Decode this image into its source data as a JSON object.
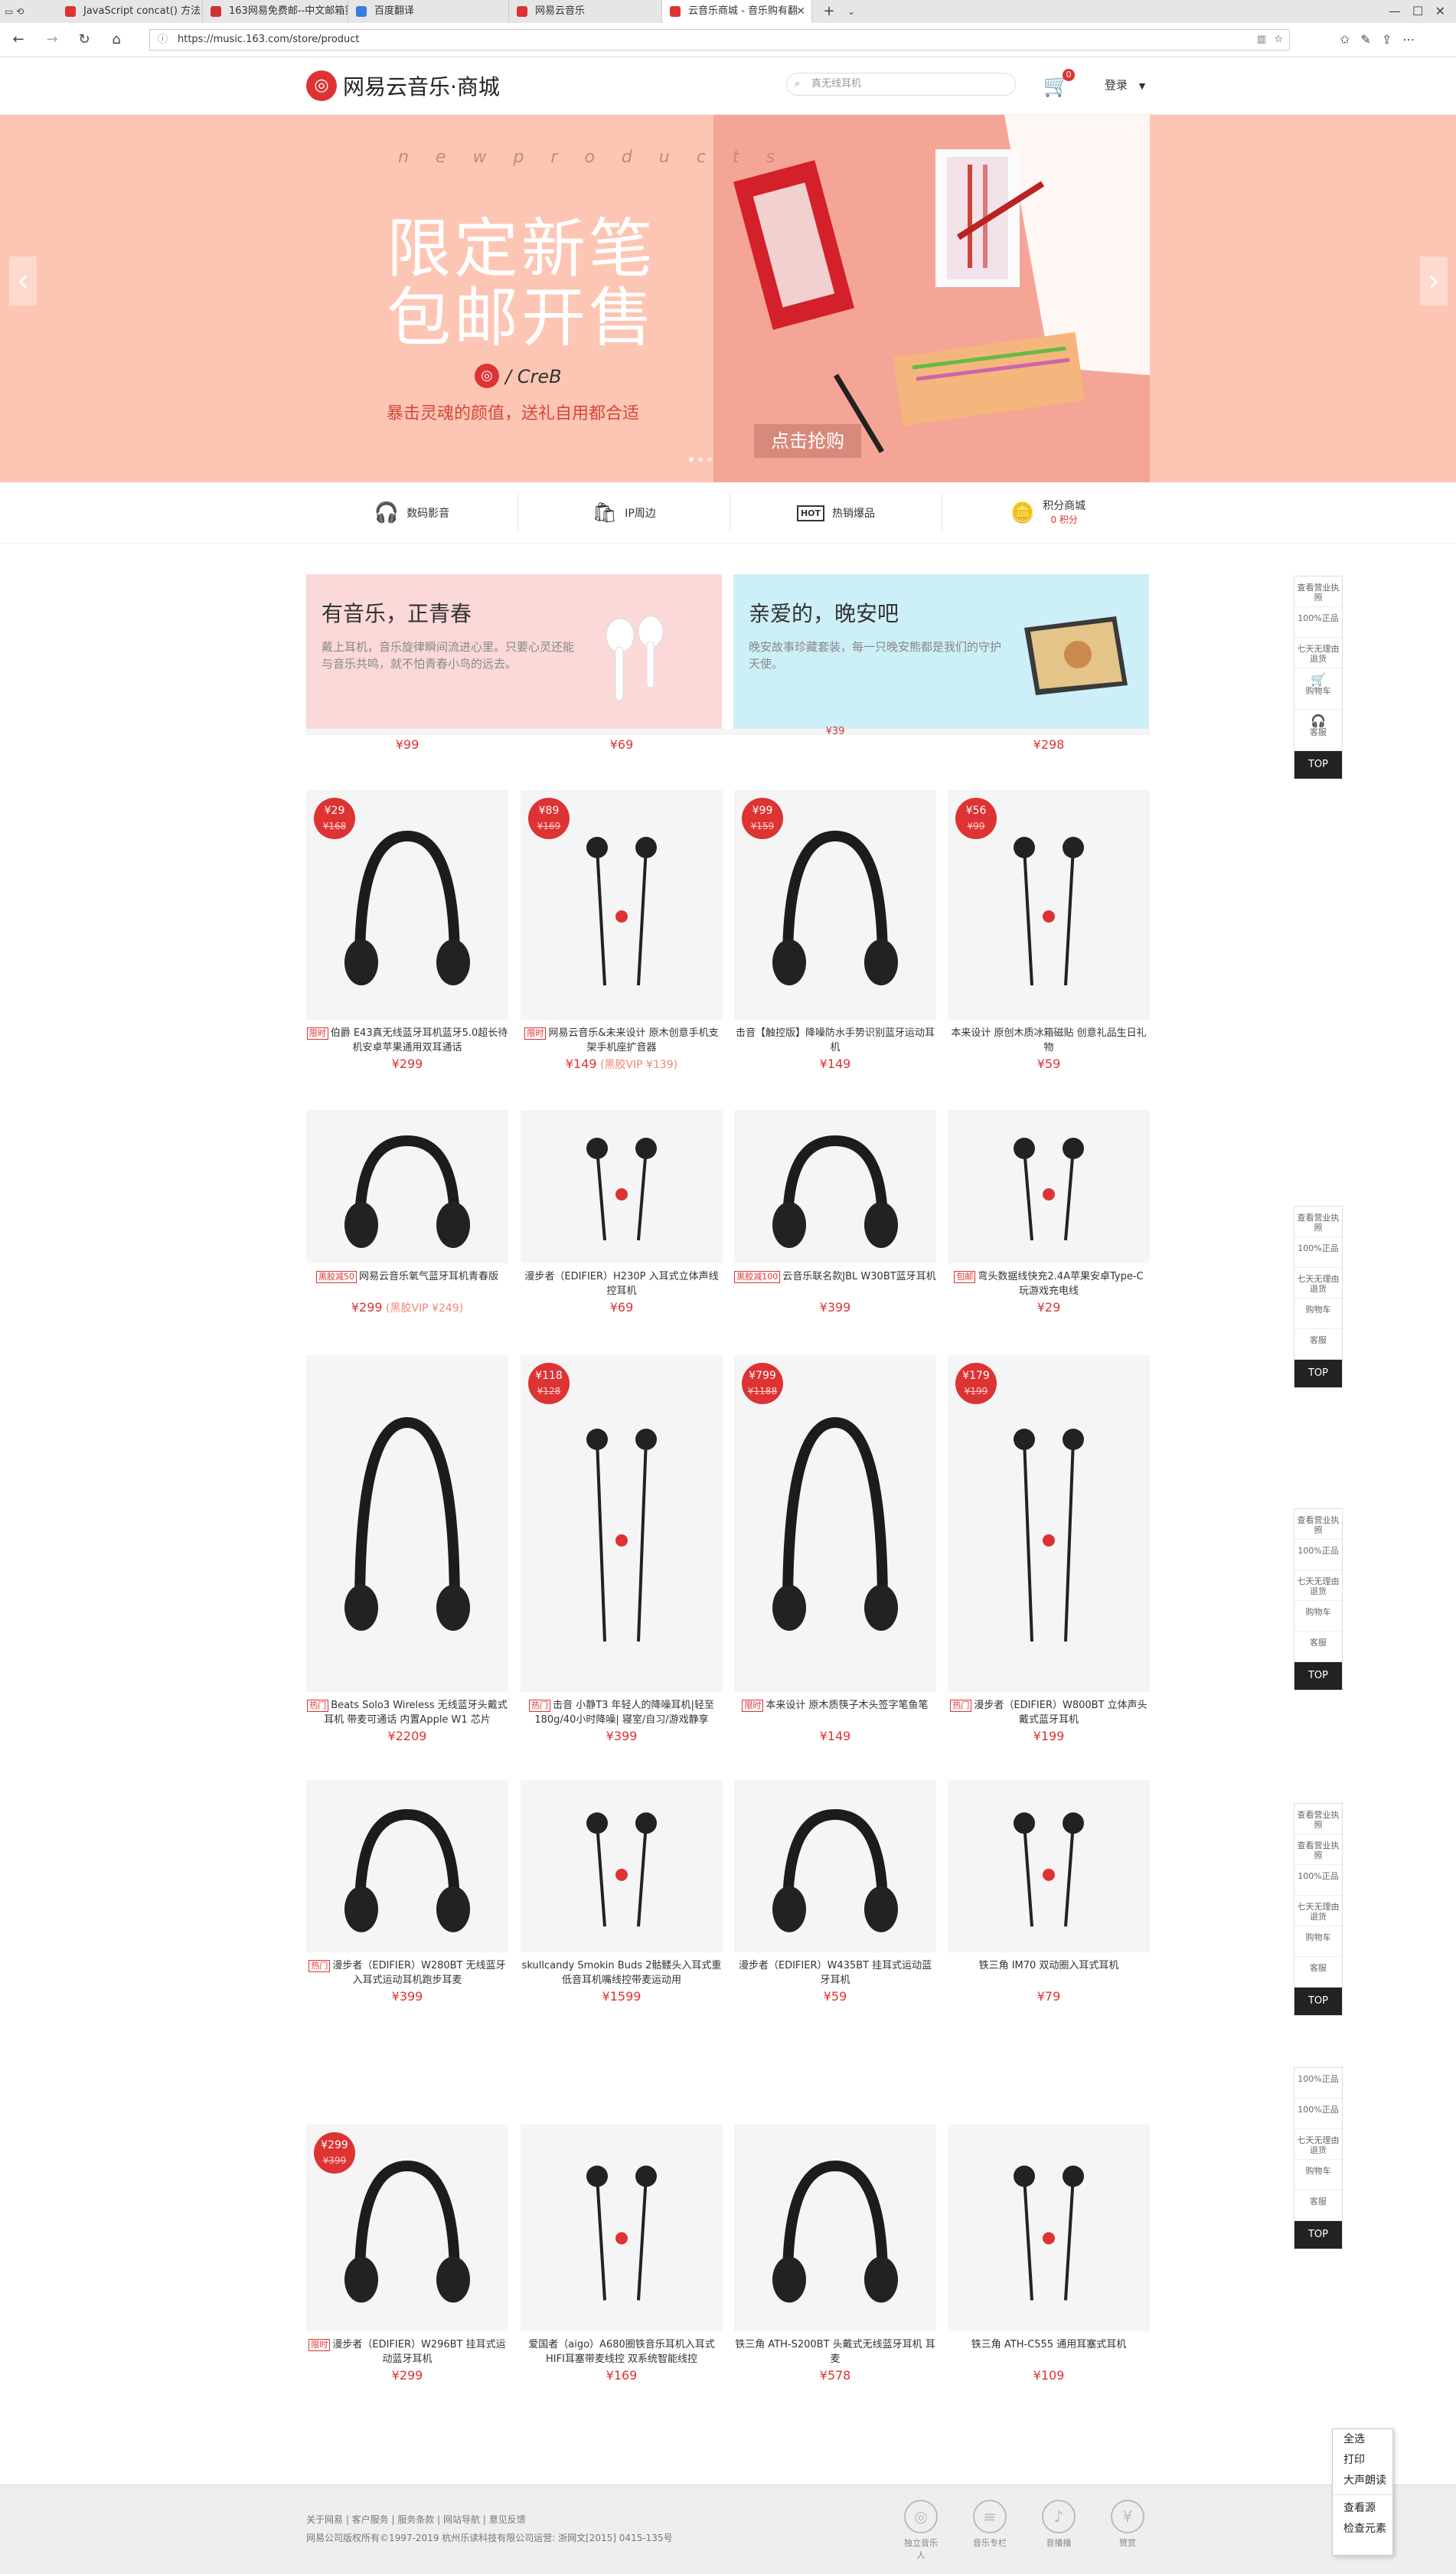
{
  "browser": {
    "tabs": [
      {
        "label": "JavaScript concat() 方法",
        "color": "#d33"
      },
      {
        "label": "163网易免费邮--中文邮箱第",
        "color": "#c33"
      },
      {
        "label": "百度翻译",
        "color": "#3a7be0"
      },
      {
        "label": "网易云音乐",
        "color": "#d33"
      },
      {
        "label": "云音乐商城 - 音乐购有翻",
        "color": "#d33",
        "active": true
      }
    ],
    "url": "https://music.163.com/store/product"
  },
  "header": {
    "logo_text": "网易云音乐·商城",
    "search_placeholder": "真无线耳机",
    "cart_count": "0",
    "login_label": "登录"
  },
  "banner": {
    "tagline": "n e w p r o d u c t s",
    "title_line1": "限定新笔",
    "title_line2": "包邮开售",
    "brand": "/ CreB",
    "subtitle": "暴击灵魂的颜值，送礼自用都合适",
    "cta": "点击抢购",
    "prev": "‹",
    "next": "›"
  },
  "categories": [
    {
      "label": "数码影音",
      "icon": "headphones-icon",
      "glyph": "🎧"
    },
    {
      "label": "IP周边",
      "icon": "bag-icon",
      "glyph": "🛍"
    },
    {
      "label": "热销爆品",
      "icon": "hot-icon",
      "glyph": "HOT"
    },
    {
      "label": "积分商城",
      "sub": "0 积分",
      "icon": "coins-icon",
      "glyph": "🪙"
    }
  ],
  "promos": [
    {
      "title": "有音乐，正青春",
      "desc": "戴上耳机，音乐旋律瞬间流进心里。只要心灵还能与音乐共鸣，就不怕青春小鸟的远去。",
      "bg": "#fbd9d9"
    },
    {
      "title": "亲爱的，晚安吧",
      "desc": "晚安故事珍藏套装，每一只晚安熊都是我们的守护天使。",
      "bg": "#cdeff7"
    }
  ],
  "partial_row_prices": [
    "¥99",
    "¥69",
    "¥39",
    "¥298"
  ],
  "rows": [
    [
      {
        "tag": "限时",
        "title": "伯爵 E43真无线蓝牙耳机蓝牙5.0超长待机安卓苹果通用双耳通话",
        "price": "¥299",
        "disc": "¥29",
        "orig": "¥168"
      },
      {
        "tag": "限时",
        "title": "网易云音乐&未来设计 原木创意手机支架手机座扩音器",
        "price": "¥149",
        "vip": "(黑胶VIP ¥139)",
        "disc": "¥89",
        "orig": "¥169"
      },
      {
        "tag": "",
        "title": "击音【触控版】降噪防水手势识别蓝牙运动耳机",
        "price": "¥149",
        "disc": "¥99",
        "orig": "¥159"
      },
      {
        "tag": "",
        "title": "本来设计 原创木质冰箱磁贴 创意礼品生日礼物",
        "price": "¥59",
        "disc": "¥56",
        "orig": "¥99"
      }
    ],
    [
      {
        "tag": "黑胶减50",
        "title": "网易云音乐氧气蓝牙耳机青春版",
        "price": "¥299",
        "vip": "(黑胶VIP ¥249)"
      },
      {
        "tag": "",
        "title": "漫步者（EDIFIER）H230P 入耳式立体声线控耳机",
        "price": "¥69"
      },
      {
        "tag": "黑胶减100",
        "title": "云音乐联名款JBL W30BT蓝牙耳机",
        "price": "¥399"
      },
      {
        "tag": "包邮",
        "title": "弯头数据线快充2.4A苹果安卓Type-C 玩游戏充电线",
        "price": "¥29"
      }
    ],
    [
      {
        "tag": "热门",
        "title": "Beats Solo3 Wireless 无线蓝牙头戴式耳机 带麦可通话 内置Apple W1 芯片",
        "price": "¥2209"
      },
      {
        "tag": "热门",
        "title": "击音 小静T3 年轻人的降噪耳机|轻至180g/40小时降噪| 寝室/自习/游戏静享",
        "price": "¥399",
        "disc": "¥118",
        "orig": "¥128"
      },
      {
        "tag": "限时",
        "title": "本来设计 原木质筷子木头签字笔鱼笔",
        "price": "¥149",
        "disc": "¥799",
        "orig": "¥1188"
      },
      {
        "tag": "热门",
        "title": "漫步者（EDIFIER）W800BT 立体声头戴式蓝牙耳机",
        "price": "¥199",
        "disc": "¥179",
        "orig": "¥199"
      }
    ],
    [
      {
        "tag": "热门",
        "title": "漫步者（EDIFIER）W280BT 无线蓝牙入耳式运动耳机跑步耳麦",
        "price": "¥399"
      },
      {
        "tag": "",
        "title": "skullcandy Smokin Buds 2骷髅头入耳式重低音耳机嘴线控带麦运动用",
        "price": "¥1599"
      },
      {
        "tag": "",
        "title": "漫步者（EDIFIER）W435BT 挂耳式运动蓝牙耳机",
        "price": "¥59"
      },
      {
        "tag": "",
        "title": "铁三角 IM70 双动圈入耳式耳机",
        "price": "¥79"
      }
    ],
    [
      {
        "tag": "限时",
        "title": "漫步者（EDIFIER）W296BT 挂耳式运动蓝牙耳机",
        "price": "¥299",
        "disc": "¥299",
        "orig": "¥399"
      },
      {
        "tag": "",
        "title": "爱国者（aigo）A680圈铁音乐耳机入耳式HIFI耳塞带麦线控 双系统智能线控",
        "price": "¥169"
      },
      {
        "tag": "",
        "title": "铁三角 ATH-S200BT 头戴式无线蓝牙耳机 耳麦",
        "price": "¥578"
      },
      {
        "tag": "",
        "title": "铁三角 ATH-C555 通用耳塞式耳机",
        "price": "¥109"
      }
    ]
  ],
  "sidebar": {
    "items": [
      "查看营业执照",
      "100%正品",
      "七天无理由退货",
      "购物车",
      "客服"
    ],
    "top": "TOP",
    "cart_count": "0"
  },
  "footer": {
    "links": "关于网易 | 客户服务 | 服务条款 | 网站导航 | 意见反馈",
    "copyright": "网易公司版权所有©1997-2019  杭州乐读科技有限公司运营: 浙网文[2015] 0415-135号",
    "icons": [
      {
        "label": "独立音乐人",
        "icon": "musician-icon"
      },
      {
        "label": "音乐专栏",
        "icon": "column-icon"
      },
      {
        "label": "音播播",
        "icon": "mic-icon"
      },
      {
        "label": "赞赏",
        "icon": "reward-icon"
      }
    ]
  },
  "context_menu": [
    "全选",
    "打印",
    "大声朗读",
    "查看源",
    "检查元素"
  ]
}
